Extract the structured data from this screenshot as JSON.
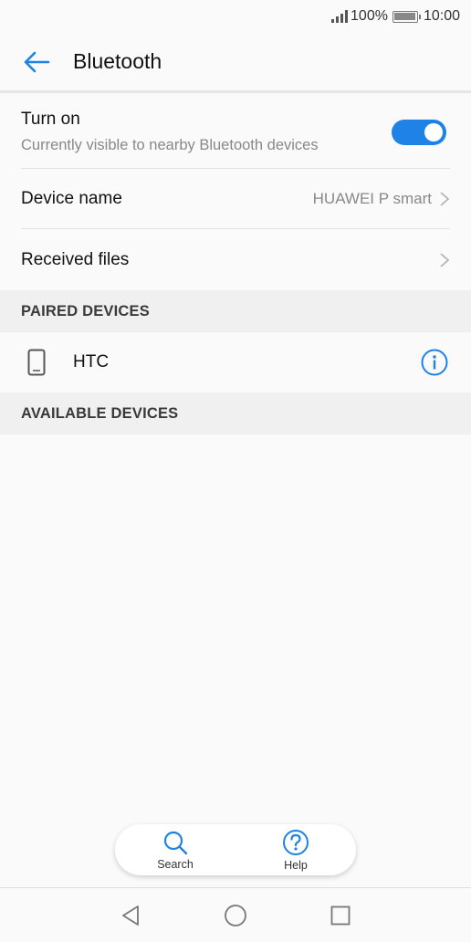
{
  "status_bar": {
    "battery_percent": "100%",
    "time": "10:00"
  },
  "app_bar": {
    "title": "Bluetooth"
  },
  "settings": {
    "turn_on": {
      "title": "Turn on",
      "subtitle": "Currently visible to nearby Bluetooth devices",
      "enabled": true
    },
    "device_name": {
      "title": "Device name",
      "value": "HUAWEI P smart"
    },
    "received_files": {
      "title": "Received files"
    }
  },
  "paired_devices": {
    "header": "PAIRED DEVICES",
    "items": [
      {
        "name": "HTC"
      }
    ]
  },
  "available_devices": {
    "header": "AVAILABLE DEVICES"
  },
  "bottom_actions": {
    "search_label": "Search",
    "help_label": "Help"
  },
  "colors": {
    "accent": "#1e82e6"
  },
  "icons": [
    "signal-icon",
    "battery-icon",
    "back-arrow-icon",
    "chevron-right-icon",
    "phone-icon",
    "info-icon",
    "search-icon",
    "help-icon",
    "nav-back-icon",
    "nav-home-icon",
    "nav-recents-icon"
  ]
}
